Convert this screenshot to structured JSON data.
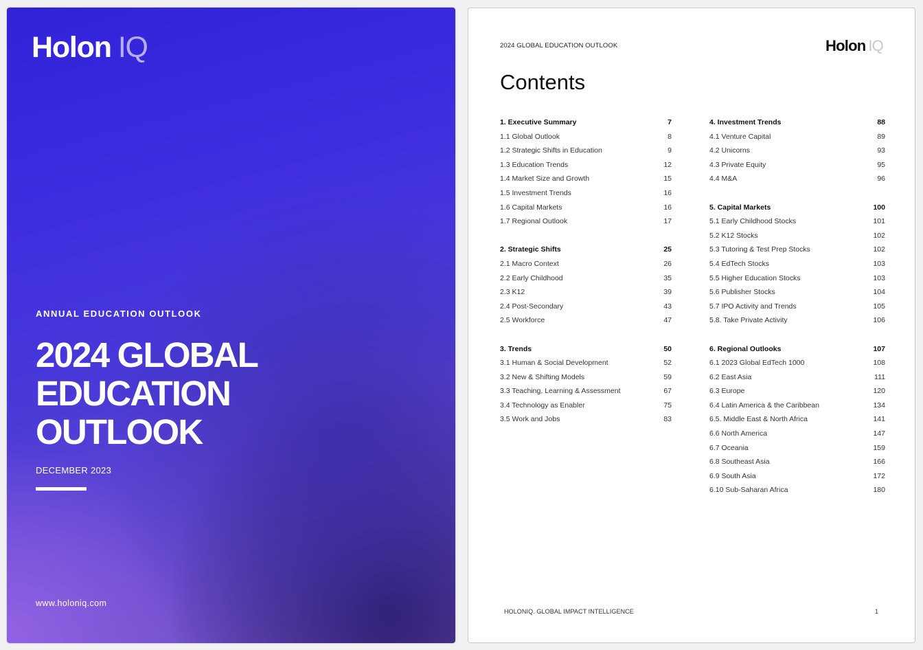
{
  "cover": {
    "logo_main": "Holon",
    "logo_iq": "IQ",
    "kicker": "ANNUAL EDUCATION OUTLOOK",
    "title_lines": [
      "2024 GLOBAL",
      "EDUCATION",
      "OUTLOOK"
    ],
    "date": "DECEMBER 2023",
    "url": "www.holoniq.com"
  },
  "page": {
    "header": "2024 GLOBAL EDUCATION OUTLOOK",
    "logo_main": "Holon",
    "logo_iq": "IQ",
    "heading": "Contents",
    "footer": "HOLONIQ. GLOBAL IMPACT INTELLIGENCE",
    "page_number": "1"
  },
  "toc": {
    "left": [
      {
        "sections": [
          {
            "label": "1. Executive Summary",
            "page": "7",
            "head": true
          },
          {
            "label": "1.1 Global Outlook",
            "page": "8"
          },
          {
            "label": "1.2 Strategic Shifts in Education",
            "page": "9"
          },
          {
            "label": "1.3 Education Trends",
            "page": "12"
          },
          {
            "label": "1.4 Market Size and Growth",
            "page": "15"
          },
          {
            "label": "1.5 Investment Trends",
            "page": "16"
          },
          {
            "label": "1.6 Capital Markets",
            "page": "16"
          },
          {
            "label": "1.7 Regional Outlook",
            "page": "17"
          }
        ]
      },
      {
        "sections": [
          {
            "label": "2. Strategic Shifts",
            "page": "25",
            "head": true
          },
          {
            "label": "2.1 Macro Context",
            "page": "26"
          },
          {
            "label": "2.2 Early Childhood",
            "page": "35"
          },
          {
            "label": "2.3 K12",
            "page": "39"
          },
          {
            "label": "2.4 Post-Secondary",
            "page": "43"
          },
          {
            "label": "2.5 Workforce",
            "page": "47"
          }
        ]
      },
      {
        "sections": [
          {
            "label": "3. Trends",
            "page": "50",
            "head": true
          },
          {
            "label": "3.1 Human & Social Development",
            "page": "52"
          },
          {
            "label": "3.2 New & Shifting Models",
            "page": "59"
          },
          {
            "label": "3.3 Teaching, Learning & Assessment",
            "page": "67"
          },
          {
            "label": "3.4 Technology as Enabler",
            "page": "75"
          },
          {
            "label": "3.5 Work and Jobs",
            "page": "83"
          }
        ]
      }
    ],
    "right": [
      {
        "sections": [
          {
            "label": "4. Investment Trends",
            "page": "88",
            "head": true
          },
          {
            "label": "4.1 Venture Capital",
            "page": "89"
          },
          {
            "label": "4.2 Unicorns",
            "page": "93"
          },
          {
            "label": "4.3 Private Equity",
            "page": "95"
          },
          {
            "label": "4.4 M&A",
            "page": "96"
          }
        ]
      },
      {
        "sections": [
          {
            "label": "5. Capital Markets",
            "page": "100",
            "head": true
          },
          {
            "label": "5.1 Early Childhood Stocks",
            "page": "101"
          },
          {
            "label": "5.2 K12 Stocks",
            "page": "102"
          },
          {
            "label": "5.3 Tutoring & Test Prep Stocks",
            "page": "102"
          },
          {
            "label": "5.4 EdTech Stocks",
            "page": "103"
          },
          {
            "label": "5.5 Higher Education Stocks",
            "page": "103"
          },
          {
            "label": "5.6 Publisher Stocks",
            "page": "104"
          },
          {
            "label": "5.7 IPO Activity and Trends",
            "page": "105"
          },
          {
            "label": "5.8. Take Private Activity",
            "page": "106"
          }
        ]
      },
      {
        "sections": [
          {
            "label": "6. Regional Outlooks",
            "page": "107",
            "head": true
          },
          {
            "label": "6.1 2023 Global EdTech 1000",
            "page": "108"
          },
          {
            "label": "6.2 East Asia",
            "page": "111"
          },
          {
            "label": "6.3 Europe",
            "page": "120"
          },
          {
            "label": "6.4 Latin America & the Caribbean",
            "page": "134"
          },
          {
            "label": "6.5. Middle East & North Africa",
            "page": "141"
          },
          {
            "label": "6.6 North America",
            "page": "147"
          },
          {
            "label": "6.7 Oceania",
            "page": "159"
          },
          {
            "label": "6.8 Southeast Asia",
            "page": "166"
          },
          {
            "label": "6.9 South Asia",
            "page": "172"
          },
          {
            "label": "6.10 Sub-Saharan Africa",
            "page": "180"
          }
        ]
      }
    ]
  }
}
